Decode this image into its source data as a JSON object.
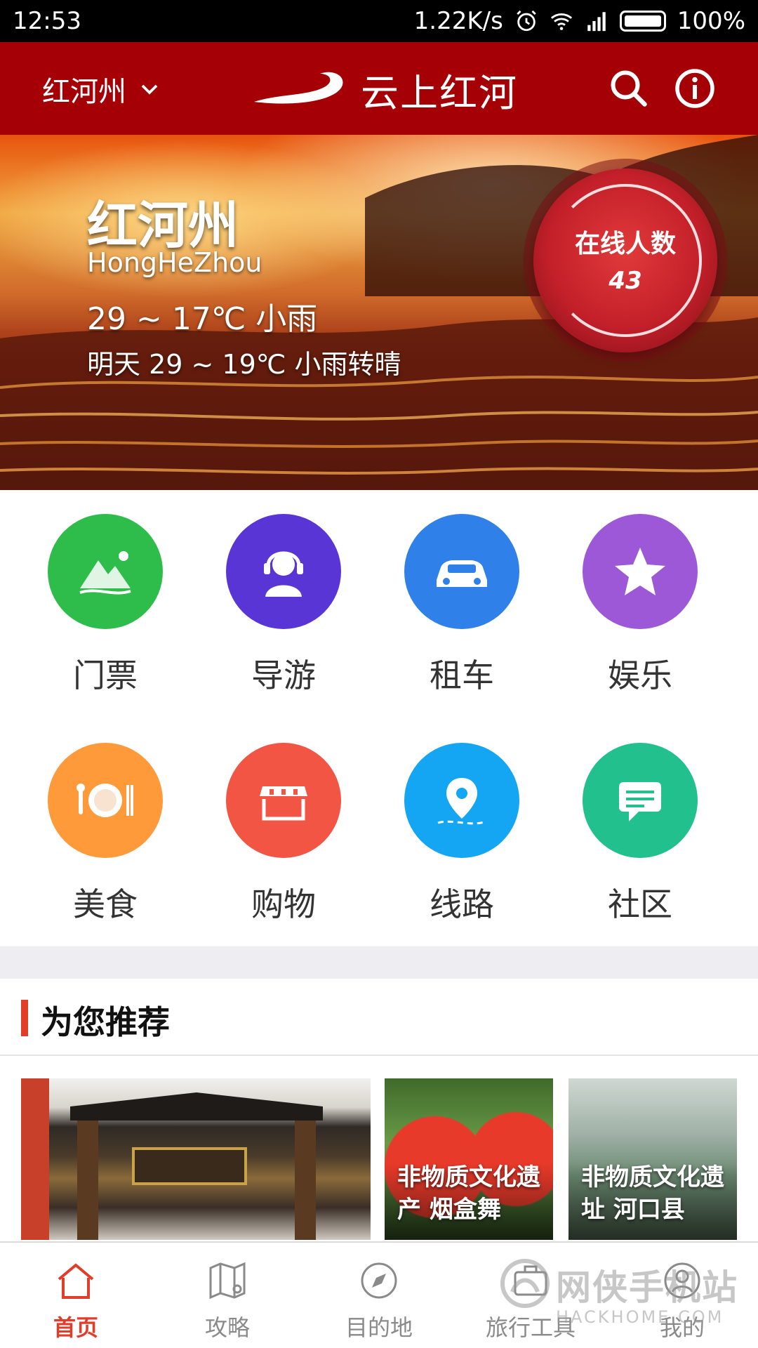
{
  "status_bar": {
    "time": "12:53",
    "net_speed": "1.22K/s",
    "battery": "100%"
  },
  "header": {
    "city": "红河州",
    "app_title": "云上红河"
  },
  "hero": {
    "name": "红河州",
    "pinyin": "HongHeZhou",
    "today": "29 ~ 17℃ 小雨",
    "tomorrow": "明天 29 ~ 19℃ 小雨转晴",
    "online_label": "在线人数",
    "online_count": "43"
  },
  "features": [
    {
      "label": "门票",
      "icon": "mountain-ticket-icon",
      "color": "#2ebd4a"
    },
    {
      "label": "导游",
      "icon": "headset-guide-icon",
      "color": "#5a35d6"
    },
    {
      "label": "租车",
      "icon": "car-icon",
      "color": "#2f80e8"
    },
    {
      "label": "娱乐",
      "icon": "star-icon",
      "color": "#9c58d6"
    },
    {
      "label": "美食",
      "icon": "plate-cutlery-icon",
      "color": "#ff9a3a"
    },
    {
      "label": "购物",
      "icon": "shop-icon",
      "color": "#f25543"
    },
    {
      "label": "线路",
      "icon": "location-route-icon",
      "color": "#14a6f2"
    },
    {
      "label": "社区",
      "icon": "chat-icon",
      "color": "#21c08d"
    }
  ],
  "recommend": {
    "title": "为您推荐",
    "cards": [
      {
        "caption": ""
      },
      {
        "caption": "非物质文化遗产 烟盒舞"
      },
      {
        "caption": "非物质文化遗址 河口县"
      }
    ]
  },
  "bottom_nav": [
    {
      "label": "首页",
      "icon": "home-icon",
      "active": true
    },
    {
      "label": "攻略",
      "icon": "map-guide-icon",
      "active": false
    },
    {
      "label": "目的地",
      "icon": "compass-icon",
      "active": false
    },
    {
      "label": "旅行工具",
      "icon": "toolbox-icon",
      "active": false
    },
    {
      "label": "我的",
      "icon": "user-icon",
      "active": false
    }
  ],
  "watermark": {
    "text": "网侠手机站",
    "url": "HACKHOME.COM"
  },
  "colors": {
    "header_red": "#a50005",
    "accent_red": "#e23d2b"
  }
}
